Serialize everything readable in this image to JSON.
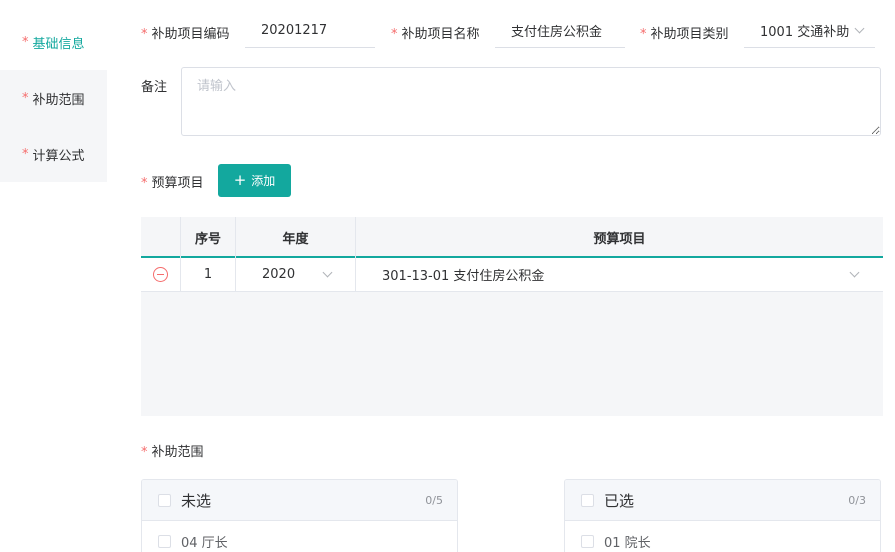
{
  "sidebar": {
    "items": [
      {
        "label": "基础信息",
        "required": true
      },
      {
        "label": "补助范围",
        "required": true
      },
      {
        "label": "计算公式",
        "required": true
      }
    ]
  },
  "form": {
    "code_label": "补助项目编码",
    "code_value": "20201217",
    "name_label": "补助项目名称",
    "name_value": "支付住房公积金",
    "type_label": "补助项目类别",
    "type_value": "1001 交通补助",
    "remark_label": "备注",
    "remark_placeholder": "请输入",
    "budget_label": "预算项目",
    "add_button": "添加"
  },
  "table": {
    "headers": [
      "序号",
      "年度",
      "预算项目"
    ],
    "rows": [
      {
        "index": "1",
        "year": "2020",
        "budget_item": "301-13-01 支付住房公积金"
      }
    ]
  },
  "scope": {
    "label": "补助范围",
    "left": {
      "title": "未选",
      "count": "0/5",
      "items": [
        "04 厅长"
      ]
    },
    "right": {
      "title": "已选",
      "count": "0/3",
      "items": [
        "01 院长"
      ]
    }
  },
  "colors": {
    "accent": "#13a89e",
    "required": "#f56c6c",
    "muted_bg": "#f5f6f8"
  }
}
